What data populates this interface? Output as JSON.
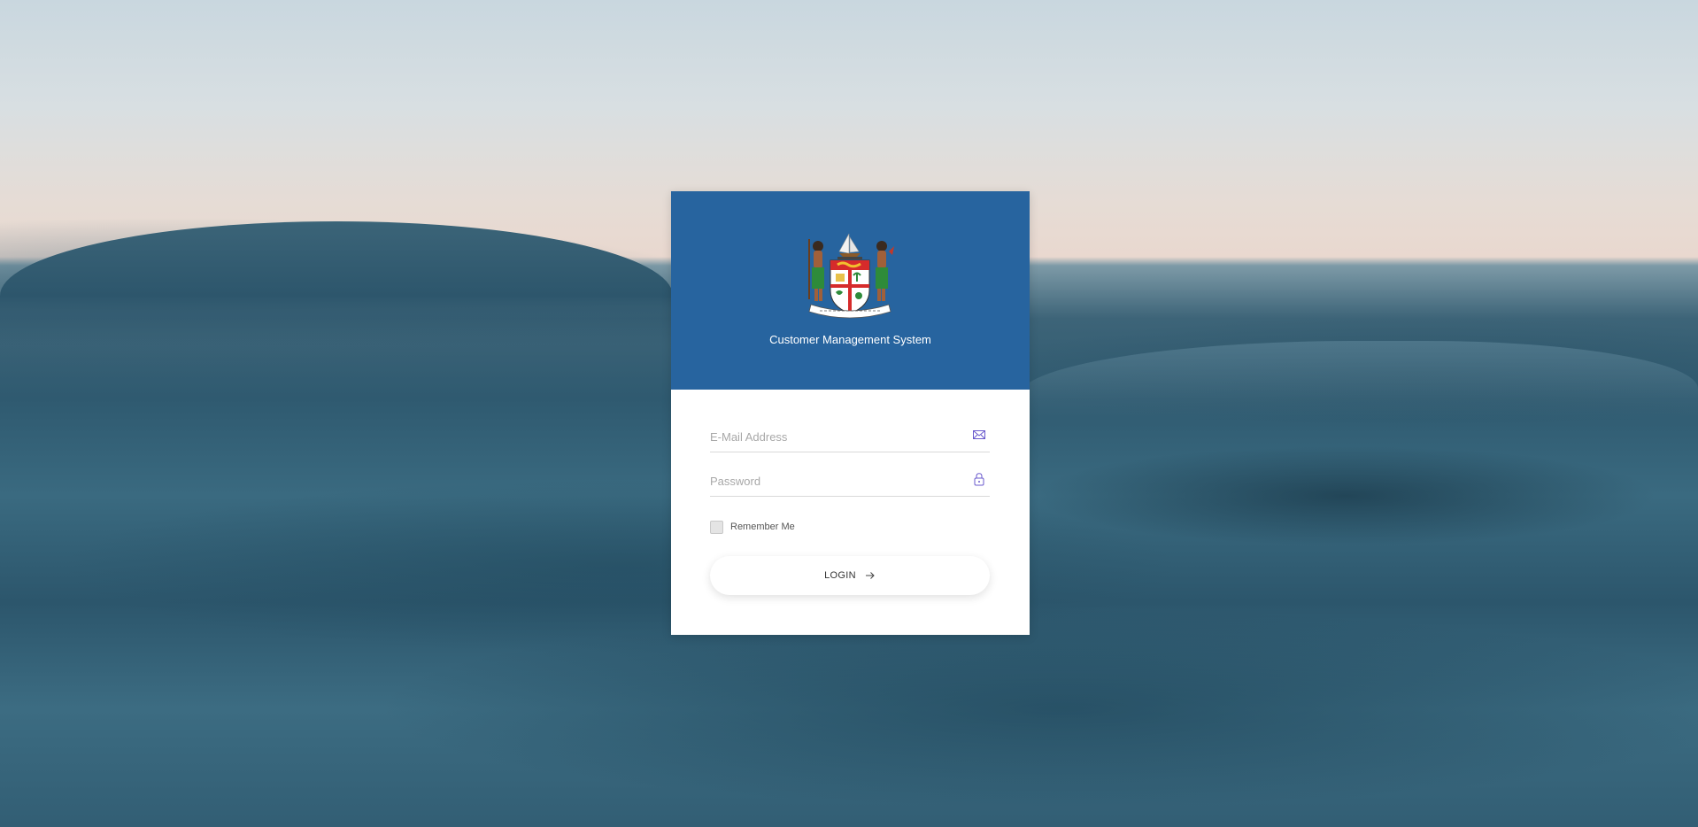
{
  "header": {
    "title": "Customer Management System",
    "crest_motto": "Rerevaka na Kalou ka Doka na Tui",
    "color": "#27649f"
  },
  "form": {
    "email_placeholder": "E-Mail Address",
    "email_value": "",
    "password_placeholder": "Password",
    "password_value": "",
    "remember_label": "Remember Me",
    "remember_checked": false,
    "login_label": "LOGIN",
    "icons": {
      "email": "envelope-icon",
      "password": "lock-icon",
      "login": "arrow-right-icon"
    },
    "icon_color": "#6a5acd"
  }
}
